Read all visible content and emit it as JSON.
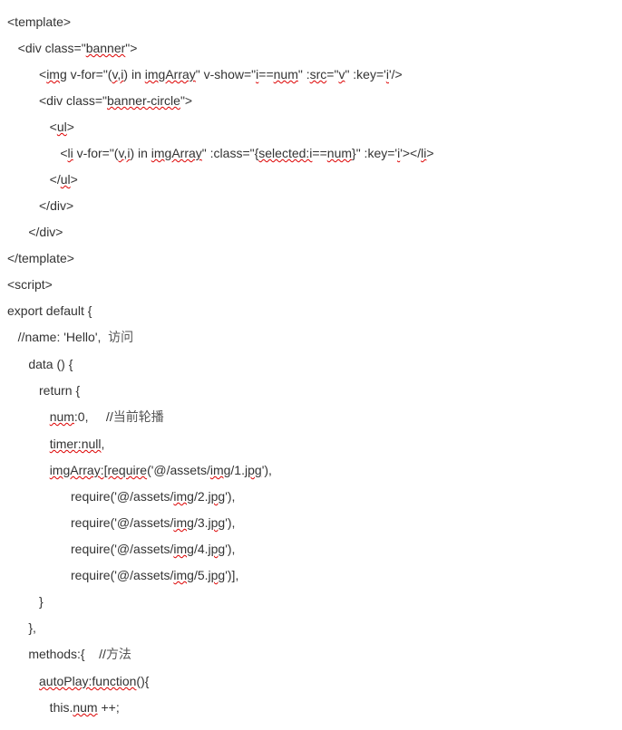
{
  "lines": [
    {
      "indent": 0,
      "segs": [
        {
          "t": "<template>"
        }
      ]
    },
    {
      "indent": 1,
      "segs": [
        {
          "t": "<div class=\""
        },
        {
          "t": "banner",
          "sq": true
        },
        {
          "t": "\">"
        }
      ]
    },
    {
      "indent": 3,
      "segs": [
        {
          "t": "<"
        },
        {
          "t": "img",
          "sq": true
        },
        {
          "t": " v-for=\"("
        },
        {
          "t": "v,i",
          "sq": true
        },
        {
          "t": ") in "
        },
        {
          "t": "imgArray",
          "sq": true
        },
        {
          "t": "\" v-show=\""
        },
        {
          "t": "i",
          "sq": true
        },
        {
          "t": "=="
        },
        {
          "t": "num",
          "sq": true
        },
        {
          "t": "\" :"
        },
        {
          "t": "src",
          "sq": true
        },
        {
          "t": "=\""
        },
        {
          "t": "v",
          "sq": true
        },
        {
          "t": "\" :key='"
        },
        {
          "t": "i",
          "sq": true
        },
        {
          "t": "'/>"
        }
      ]
    },
    {
      "indent": 3,
      "segs": [
        {
          "t": "<div class=\""
        },
        {
          "t": "banner-circle",
          "sq": true
        },
        {
          "t": "\">"
        }
      ]
    },
    {
      "indent": 4,
      "segs": [
        {
          "t": "<"
        },
        {
          "t": "ul",
          "sq": true
        },
        {
          "t": ">"
        }
      ]
    },
    {
      "indent": 5,
      "segs": [
        {
          "t": "<"
        },
        {
          "t": "li",
          "sq": true
        },
        {
          "t": " v-for=\"("
        },
        {
          "t": "v,i",
          "sq": true
        },
        {
          "t": ") in "
        },
        {
          "t": "imgArray",
          "sq": true
        },
        {
          "t": "\" :class=\"{"
        },
        {
          "t": "selected:i",
          "sq": true
        },
        {
          "t": "=="
        },
        {
          "t": "num",
          "sq": true
        },
        {
          "t": "}\" :key='"
        },
        {
          "t": "i",
          "sq": true
        },
        {
          "t": "'></"
        },
        {
          "t": "li",
          "sq": true
        },
        {
          "t": ">"
        }
      ]
    },
    {
      "indent": 4,
      "segs": [
        {
          "t": "</"
        },
        {
          "t": "ul",
          "sq": true
        },
        {
          "t": ">"
        }
      ]
    },
    {
      "indent": 3,
      "segs": [
        {
          "t": "</div>"
        }
      ]
    },
    {
      "indent": 2,
      "segs": [
        {
          "t": "</div>"
        }
      ]
    },
    {
      "indent": 0,
      "segs": [
        {
          "t": "</template>"
        }
      ]
    },
    {
      "indent": 0,
      "segs": [
        {
          "t": "<script>"
        }
      ]
    },
    {
      "indent": 0,
      "segs": [
        {
          "t": "export default {"
        }
      ]
    },
    {
      "indent": 1,
      "segs": [
        {
          "t": "//name: 'Hello',  "
        },
        {
          "t": "访问",
          "cn": true
        }
      ]
    },
    {
      "indent": 2,
      "segs": [
        {
          "t": "data () {"
        }
      ]
    },
    {
      "indent": 3,
      "segs": [
        {
          "t": "return {"
        }
      ]
    },
    {
      "indent": 4,
      "segs": [
        {
          "t": "num",
          "sq": true
        },
        {
          "t": ":0,     //"
        },
        {
          "t": "当前轮播",
          "cn": true
        }
      ]
    },
    {
      "indent": 4,
      "segs": [
        {
          "t": "timer:null",
          "sq": true
        },
        {
          "t": ","
        }
      ]
    },
    {
      "indent": 4,
      "segs": [
        {
          "t": "imgArray:[require",
          "sq": true
        },
        {
          "t": "('@/assets/"
        },
        {
          "t": "img",
          "sq": true
        },
        {
          "t": "/1."
        },
        {
          "t": "jpg",
          "sq": true
        },
        {
          "t": "'),"
        }
      ]
    },
    {
      "indent": 6,
      "segs": [
        {
          "t": "require('@/assets/"
        },
        {
          "t": "img",
          "sq": true
        },
        {
          "t": "/2."
        },
        {
          "t": "jpg",
          "sq": true
        },
        {
          "t": "'),"
        }
      ]
    },
    {
      "indent": 6,
      "segs": [
        {
          "t": "require('@/assets/"
        },
        {
          "t": "img",
          "sq": true
        },
        {
          "t": "/3."
        },
        {
          "t": "jpg",
          "sq": true
        },
        {
          "t": "'),"
        }
      ]
    },
    {
      "indent": 6,
      "segs": [
        {
          "t": "require('@/assets/"
        },
        {
          "t": "img",
          "sq": true
        },
        {
          "t": "/4."
        },
        {
          "t": "jpg",
          "sq": true
        },
        {
          "t": "'),"
        }
      ]
    },
    {
      "indent": 6,
      "segs": [
        {
          "t": "require('@/assets/"
        },
        {
          "t": "img",
          "sq": true
        },
        {
          "t": "/5."
        },
        {
          "t": "jpg",
          "sq": true
        },
        {
          "t": "')],"
        }
      ]
    },
    {
      "indent": 3,
      "segs": [
        {
          "t": "}"
        }
      ]
    },
    {
      "indent": 2,
      "segs": [
        {
          "t": "},"
        }
      ]
    },
    {
      "indent": 2,
      "segs": [
        {
          "t": "methods:{    //"
        },
        {
          "t": "方法",
          "cn": true
        }
      ]
    },
    {
      "indent": 3,
      "segs": [
        {
          "t": "autoPlay:function",
          "sq": true
        },
        {
          "t": "(){"
        }
      ]
    },
    {
      "indent": 4,
      "segs": [
        {
          "t": "this."
        },
        {
          "t": "num",
          "sq": true
        },
        {
          "t": " ++;"
        }
      ]
    }
  ],
  "indentUnit": "   "
}
